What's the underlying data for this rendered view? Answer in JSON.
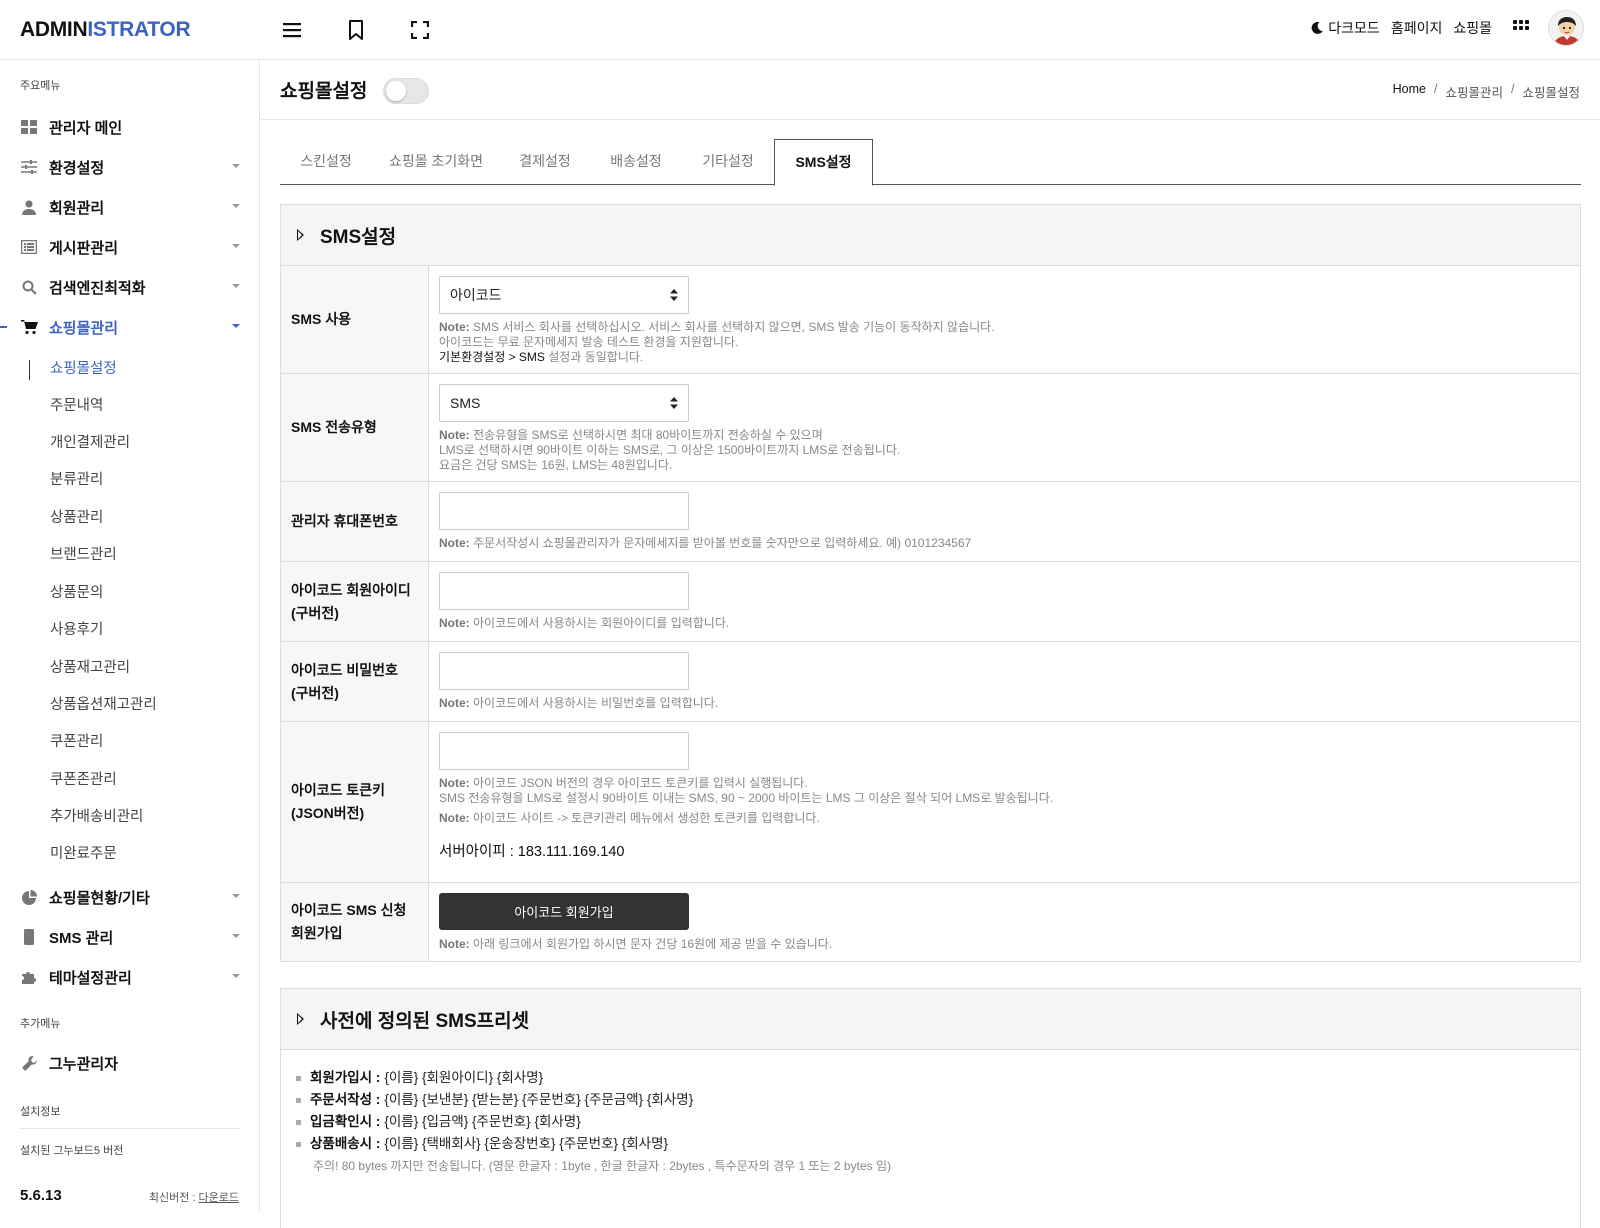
{
  "header": {
    "logo_part1": "ADMIN",
    "logo_part2": "ISTRATOR",
    "dark_mode": "다크모드",
    "homepage": "홈페이지",
    "shop": "쇼핑몰"
  },
  "sidebar": {
    "main_section": "주요메뉴",
    "menu": [
      {
        "label": "관리자 메인",
        "icon": "dashboard-icon"
      },
      {
        "label": "환경설정",
        "icon": "sliders-icon"
      },
      {
        "label": "회원관리",
        "icon": "user-icon"
      },
      {
        "label": "게시판관리",
        "icon": "list-icon"
      },
      {
        "label": "검색엔진최적화",
        "icon": "search-icon"
      },
      {
        "label": "쇼핑몰관리",
        "icon": "cart-icon"
      }
    ],
    "submenu": [
      "쇼핑몰설정",
      "주문내역",
      "개인결제관리",
      "분류관리",
      "상품관리",
      "브랜드관리",
      "상품문의",
      "사용후기",
      "상품재고관리",
      "상품옵션재고관리",
      "쿠폰관리",
      "쿠폰존관리",
      "추가배송비관리",
      "미완료주문"
    ],
    "menu2": [
      {
        "label": "쇼핑몰현황/기타",
        "icon": "pie-chart-icon"
      },
      {
        "label": "SMS 관리",
        "icon": "phone-icon"
      },
      {
        "label": "테마설정관리",
        "icon": "puzzle-icon"
      }
    ],
    "extra_section": "추가메뉴",
    "extra_item": "그누관리자",
    "install_section": "설치정보",
    "version_label": "설치된 그누보드5 버전",
    "version": "5.6.13",
    "latest_label": "최신버전 : ",
    "latest_link": "다운로드"
  },
  "page": {
    "title": "쇼핑몰설정",
    "breadcrumb": [
      "Home",
      "/",
      "쇼핑몰관리",
      "/",
      "쇼핑몰설정"
    ],
    "tabs": [
      "스킨설정",
      "쇼핑몰 초기화면",
      "결제설정",
      "배송설정",
      "기타설정",
      "SMS설정"
    ],
    "active_tab": "SMS설정"
  },
  "sms_panel": {
    "title": "SMS설정",
    "sms_use": {
      "label": "SMS 사용",
      "value": "아이코드",
      "note_key": "Note:",
      "note1": " SMS 서비스 회사를 선택하십시오. 서비스 회사를 선택하지 않으면, SMS 발송 기능이 동작하지 않습니다.",
      "note2": "아이코드는 무료 문자메세지 발송 테스트 환경을 지원합니다.",
      "note3_dark": "기본환경설정 > SMS",
      "note3": " 설정과 동일합니다."
    },
    "sms_type": {
      "label": "SMS 전송유형",
      "value": "SMS",
      "note_key": "Note:",
      "note1": " 전송유형을 SMS로 선택하시면 최대 80바이트까지 전송하실 수 있으며",
      "note2": "LMS로 선택하시면 90바이트 이하는 SMS로, 그 이상은 1500바이트까지 LMS로 전송됩니다.",
      "note3": "요금은 건당 SMS는 16원, LMS는 48원입니다."
    },
    "admin_phone": {
      "label": "관리자 휴대폰번호",
      "value": "",
      "note_key": "Note:",
      "note": " 주문서작성시 쇼핑몰관리자가 문자메세지를 받아볼 번호를 숫자만으로 입력하세요. 예) 0101234567"
    },
    "icode_id": {
      "label1": "아이코드 회원아이디",
      "label2": "(구버전)",
      "value": "",
      "note_key": "Note:",
      "note": " 아이코드에서 사용하시는 회원아이디를 입력합니다."
    },
    "icode_pw": {
      "label1": "아이코드 비밀번호",
      "label2": "(구버전)",
      "value": "",
      "note_key": "Note:",
      "note": " 아이코드에서 사용하시는 비밀번호를 입력합니다."
    },
    "icode_token": {
      "label1": "아이코드 토큰키",
      "label2": "(JSON버전)",
      "value": "",
      "note_key": "Note:",
      "note1": " 아이코드 JSON 버전의 경우 아이코드 토큰키를 입력시 실행됩니다.",
      "note2": "SMS 전송유형을 LMS로 설정시 90바이트 이내는 SMS, 90 ~ 2000 바이트는 LMS 그 이상은 절삭 되어 LMS로 발송됩니다.",
      "note3_key": "Note:",
      "note3": " 아이코드 사이트 -> 토큰키관리 메뉴에서 생성한 토큰키를 입력합니다.",
      "server_ip": "서버아이피 : 183.111.169.140"
    },
    "icode_join": {
      "label1": "아이코드 SMS 신청",
      "label2": "회원가입",
      "button": "아이코드 회원가입",
      "note_key": "Note:",
      "note": " 아래 링크에서 회원가입 하시면 문자 건당 16원에 제공 받을 수 있습니다."
    }
  },
  "preset_panel": {
    "title": "사전에 정의된 SMS프리셋",
    "items": [
      {
        "key": "회원가입시 :",
        "val": "{이름} {회원아이디} {회사명}"
      },
      {
        "key": "주문서작성 :",
        "val": "{이름} {보낸분} {받는분} {주문번호} {주문금액} {회사명}"
      },
      {
        "key": "입금확인시 :",
        "val": "{이름} {입금액} {주문번호} {회사명}"
      },
      {
        "key": "상품배송시 :",
        "val": "{이름} {택배회사} {운송장번호} {주문번호} {회사명}"
      }
    ],
    "caution": "주의! 80 bytes 까지만 전송됩니다. (영문 한글자 : 1byte , 한글 한글자 : 2bytes , 특수문자의 경우 1 또는 2 bytes 임)"
  },
  "colors": {
    "accent": "#3b63c4",
    "dark_button": "#333333"
  }
}
